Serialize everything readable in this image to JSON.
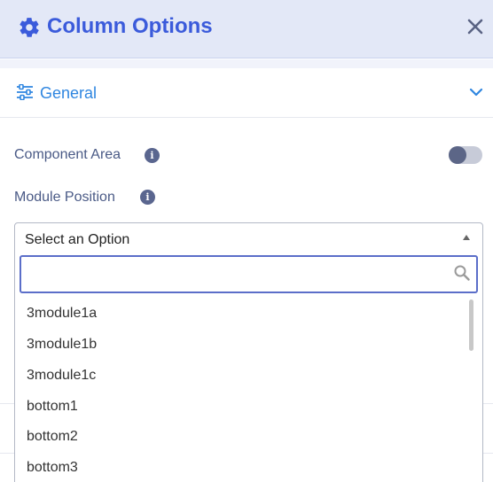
{
  "header": {
    "title": "Column Options"
  },
  "section": {
    "label": "General"
  },
  "fields": {
    "component_area": {
      "label": "Component Area",
      "info": "i",
      "toggle_on": false
    },
    "module_position": {
      "label": "Module Position",
      "info": "i"
    }
  },
  "select": {
    "selected": "Select an Option",
    "search_value": "",
    "options": [
      "3module1a",
      "3module1b",
      "3module1c",
      "bottom1",
      "bottom2",
      "bottom3"
    ]
  },
  "colors": {
    "accent": "#3b5bdb",
    "link": "#2f86e0",
    "header_bg": "#e3e8f7",
    "label": "#4a5a86"
  },
  "icons": {
    "gear": "gear-icon",
    "close": "close-icon",
    "sliders": "sliders-icon",
    "chevron": "chevron-down-icon",
    "info": "info-icon",
    "search": "search-icon",
    "caret": "caret-up-icon"
  }
}
